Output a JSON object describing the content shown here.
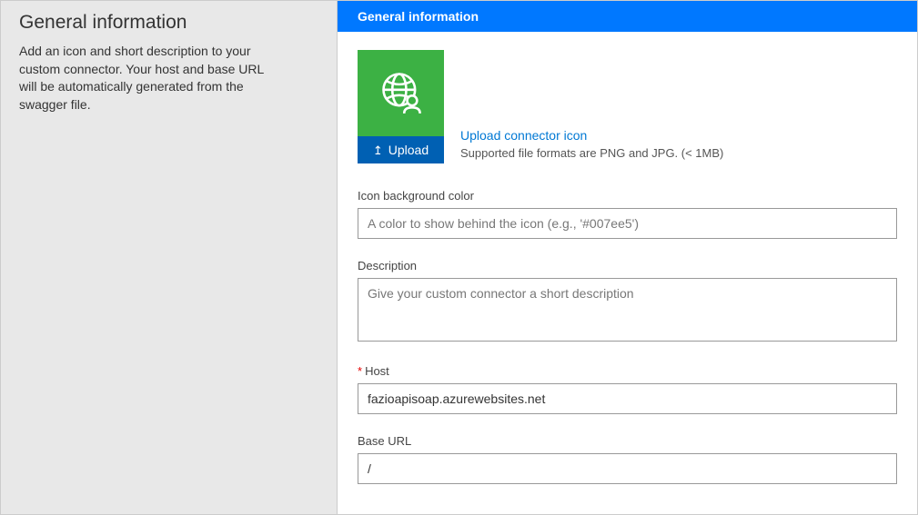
{
  "sidebar": {
    "title": "General information",
    "description": "Add an icon and short description to your custom connector. Your host and base URL will be automatically generated from the swagger file."
  },
  "header": {
    "title": "General information"
  },
  "iconSection": {
    "uploadLabel": "Upload",
    "linkText": "Upload connector icon",
    "hint": "Supported file formats are PNG and JPG. (< 1MB)",
    "bgColor": "#3cb144"
  },
  "fields": {
    "iconBg": {
      "label": "Icon background color",
      "placeholder": "A color to show behind the icon (e.g., '#007ee5')",
      "value": ""
    },
    "description": {
      "label": "Description",
      "placeholder": "Give your custom connector a short description",
      "value": ""
    },
    "host": {
      "label": "Host",
      "value": "fazioapisoap.azurewebsites.net"
    },
    "baseUrl": {
      "label": "Base URL",
      "value": "/"
    }
  }
}
